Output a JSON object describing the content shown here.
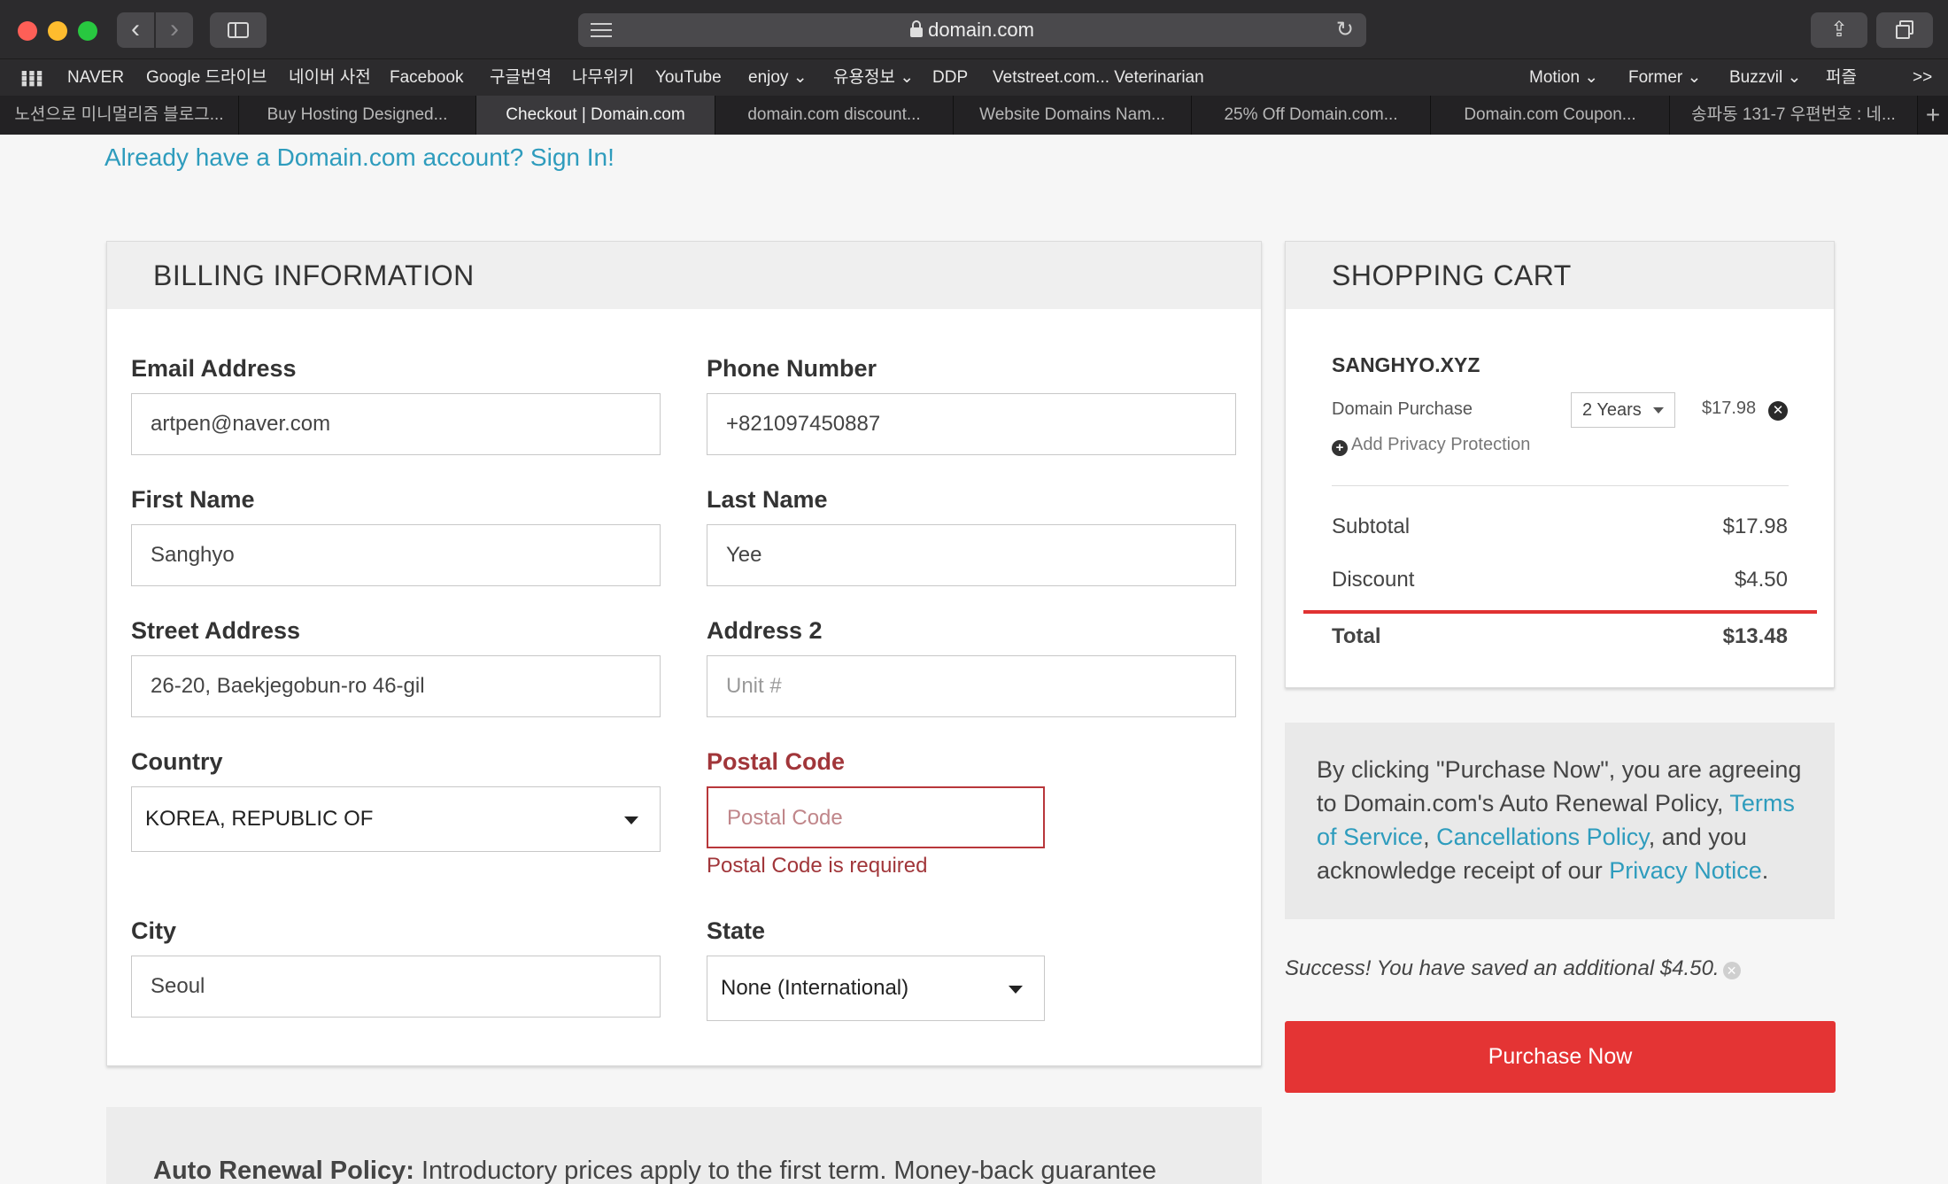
{
  "browser": {
    "url": "domain.com",
    "nav_back": "‹",
    "nav_forward": "›",
    "bookmarks_left": [
      "NAVER",
      "Google 드라이브",
      "네이버 사전",
      "Facebook",
      "구글번역",
      "나무위키",
      "YouTube",
      "enjoy ⌄",
      "유용정보 ⌄",
      "DDP",
      "Vetstreet.com... Veterinarian"
    ],
    "bookmarks_right": [
      "Motion ⌄",
      "Former ⌄",
      "Buzzvil ⌄",
      "퍼즐"
    ],
    "bookmarks_overflow": ">>",
    "tabs": [
      "노션으로 미니멀리즘 블로그...",
      "Buy Hosting Designed...",
      "Checkout | Domain.com",
      "domain.com discount...",
      "Website Domains Nam...",
      "25% Off Domain.com...",
      "Domain.com Coupon...",
      "송파동 131-7 우편번호 : 네..."
    ],
    "active_tab_index": 2,
    "new_tab": "+"
  },
  "page": {
    "signin_link": "Already have a Domain.com account? Sign In!",
    "billing": {
      "title": "BILLING INFORMATION",
      "email_label": "Email Address",
      "email_value": "artpen@naver.com",
      "phone_label": "Phone Number",
      "phone_value": "+821097450887",
      "first_name_label": "First Name",
      "first_name_value": "Sanghyo",
      "last_name_label": "Last Name",
      "last_name_value": "Yee",
      "street_label": "Street Address",
      "street_value": "26-20, Baekjegobun-ro 46-gil",
      "address2_label": "Address 2",
      "address2_placeholder": "Unit #",
      "country_label": "Country",
      "country_value": "KOREA, REPUBLIC OF",
      "postal_label": "Postal Code",
      "postal_placeholder": "Postal Code",
      "postal_error": "Postal Code is required",
      "city_label": "City",
      "city_value": "Seoul",
      "state_label": "State",
      "state_value": "None (International)"
    },
    "cart": {
      "title": "SHOPPING CART",
      "domain": "SANGHYO.XYZ",
      "item_label": "Domain Purchase",
      "term": "2 Years",
      "item_price": "$17.98",
      "add_privacy": "Add Privacy Protection",
      "subtotal_label": "Subtotal",
      "subtotal_value": "$17.98",
      "discount_label": "Discount",
      "discount_value": "$4.50",
      "total_label": "Total",
      "total_value": "$13.48"
    },
    "agreement": {
      "prefix": "By clicking \"Purchase Now\", you are agreeing to Domain.com's Auto Renewal Policy, ",
      "terms_link": "Terms of Service",
      "sep": ", ",
      "cancel_link": "Cancellations Policy",
      "middle": ", and you acknowledge receipt of our ",
      "privacy_link": "Privacy Notice",
      "suffix": "."
    },
    "success_msg": "Success! You have saved an additional $4.50.",
    "purchase_button": "Purchase Now",
    "renewal": {
      "label": "Auto Renewal Policy:",
      "text": " Introductory prices apply to the first term. Money-back guarantee"
    }
  },
  "colors": {
    "accent_link": "#2e9cbd",
    "error": "#a1363a",
    "purchase_button": "#e43434"
  }
}
